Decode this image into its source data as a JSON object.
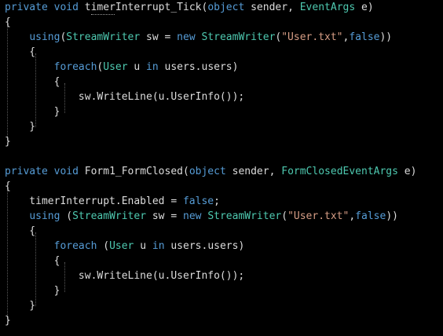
{
  "editor": {
    "theme": {
      "background": "#000000",
      "keyword": "#569cd6",
      "type": "#4ec9b0",
      "string": "#d69d85",
      "text": "#dcdcdc"
    },
    "lines": [
      [
        {
          "t": "private",
          "c": "kw"
        },
        {
          "t": " ",
          "c": "tx"
        },
        {
          "t": "void",
          "c": "kw"
        },
        {
          "t": " timerInterrupt_Tick(",
          "c": "tx"
        },
        {
          "t": "object",
          "c": "kw"
        },
        {
          "t": " sender, ",
          "c": "tx"
        },
        {
          "t": "EventArgs",
          "c": "ty"
        },
        {
          "t": " e)",
          "c": "tx"
        }
      ],
      [
        {
          "t": "{",
          "c": "tx"
        }
      ],
      [
        {
          "t": "    ",
          "c": "tx"
        },
        {
          "t": "using",
          "c": "kw"
        },
        {
          "t": "(",
          "c": "tx"
        },
        {
          "t": "StreamWriter",
          "c": "ty"
        },
        {
          "t": " sw = ",
          "c": "tx"
        },
        {
          "t": "new",
          "c": "kw"
        },
        {
          "t": " ",
          "c": "tx"
        },
        {
          "t": "StreamWriter",
          "c": "ty"
        },
        {
          "t": "(",
          "c": "tx"
        },
        {
          "t": "\"User.txt\"",
          "c": "st"
        },
        {
          "t": ",",
          "c": "tx"
        },
        {
          "t": "false",
          "c": "kw"
        },
        {
          "t": "))",
          "c": "tx"
        }
      ],
      [
        {
          "t": "    {",
          "c": "tx"
        }
      ],
      [
        {
          "t": "        ",
          "c": "tx"
        },
        {
          "t": "foreach",
          "c": "kw"
        },
        {
          "t": "(",
          "c": "tx"
        },
        {
          "t": "User",
          "c": "ty"
        },
        {
          "t": " u ",
          "c": "tx"
        },
        {
          "t": "in",
          "c": "kw"
        },
        {
          "t": " users.users)",
          "c": "tx"
        }
      ],
      [
        {
          "t": "        {",
          "c": "tx"
        }
      ],
      [
        {
          "t": "            sw.WriteLine(u.UserInfo());",
          "c": "tx"
        }
      ],
      [
        {
          "t": "        }",
          "c": "tx"
        }
      ],
      [
        {
          "t": "    }",
          "c": "tx"
        }
      ],
      [
        {
          "t": "}",
          "c": "tx"
        }
      ],
      [],
      [
        {
          "t": "private",
          "c": "kw"
        },
        {
          "t": " ",
          "c": "tx"
        },
        {
          "t": "void",
          "c": "kw"
        },
        {
          "t": " Form1_FormClosed(",
          "c": "tx"
        },
        {
          "t": "object",
          "c": "kw"
        },
        {
          "t": " sender, ",
          "c": "tx"
        },
        {
          "t": "FormClosedEventArgs",
          "c": "ty"
        },
        {
          "t": " e)",
          "c": "tx"
        }
      ],
      [
        {
          "t": "{",
          "c": "tx"
        }
      ],
      [
        {
          "t": "    timerInterrupt.Enabled = ",
          "c": "tx"
        },
        {
          "t": "false",
          "c": "kw"
        },
        {
          "t": ";",
          "c": "tx"
        }
      ],
      [
        {
          "t": "    ",
          "c": "tx"
        },
        {
          "t": "using",
          "c": "kw"
        },
        {
          "t": " (",
          "c": "tx"
        },
        {
          "t": "StreamWriter",
          "c": "ty"
        },
        {
          "t": " sw = ",
          "c": "tx"
        },
        {
          "t": "new",
          "c": "kw"
        },
        {
          "t": " ",
          "c": "tx"
        },
        {
          "t": "StreamWriter",
          "c": "ty"
        },
        {
          "t": "(",
          "c": "tx"
        },
        {
          "t": "\"User.txt\"",
          "c": "st"
        },
        {
          "t": ",",
          "c": "tx"
        },
        {
          "t": "false",
          "c": "kw"
        },
        {
          "t": "))",
          "c": "tx"
        }
      ],
      [
        {
          "t": "    {",
          "c": "tx"
        }
      ],
      [
        {
          "t": "        ",
          "c": "tx"
        },
        {
          "t": "foreach",
          "c": "kw"
        },
        {
          "t": " (",
          "c": "tx"
        },
        {
          "t": "User",
          "c": "ty"
        },
        {
          "t": " u ",
          "c": "tx"
        },
        {
          "t": "in",
          "c": "kw"
        },
        {
          "t": " users.users)",
          "c": "tx"
        }
      ],
      [
        {
          "t": "        {",
          "c": "tx"
        }
      ],
      [
        {
          "t": "            sw.WriteLine(u.UserInfo());",
          "c": "tx"
        }
      ],
      [
        {
          "t": "        }",
          "c": "tx"
        }
      ],
      [
        {
          "t": "    }",
          "c": "tx"
        }
      ],
      [
        {
          "t": "}",
          "c": "tx"
        }
      ]
    ]
  }
}
